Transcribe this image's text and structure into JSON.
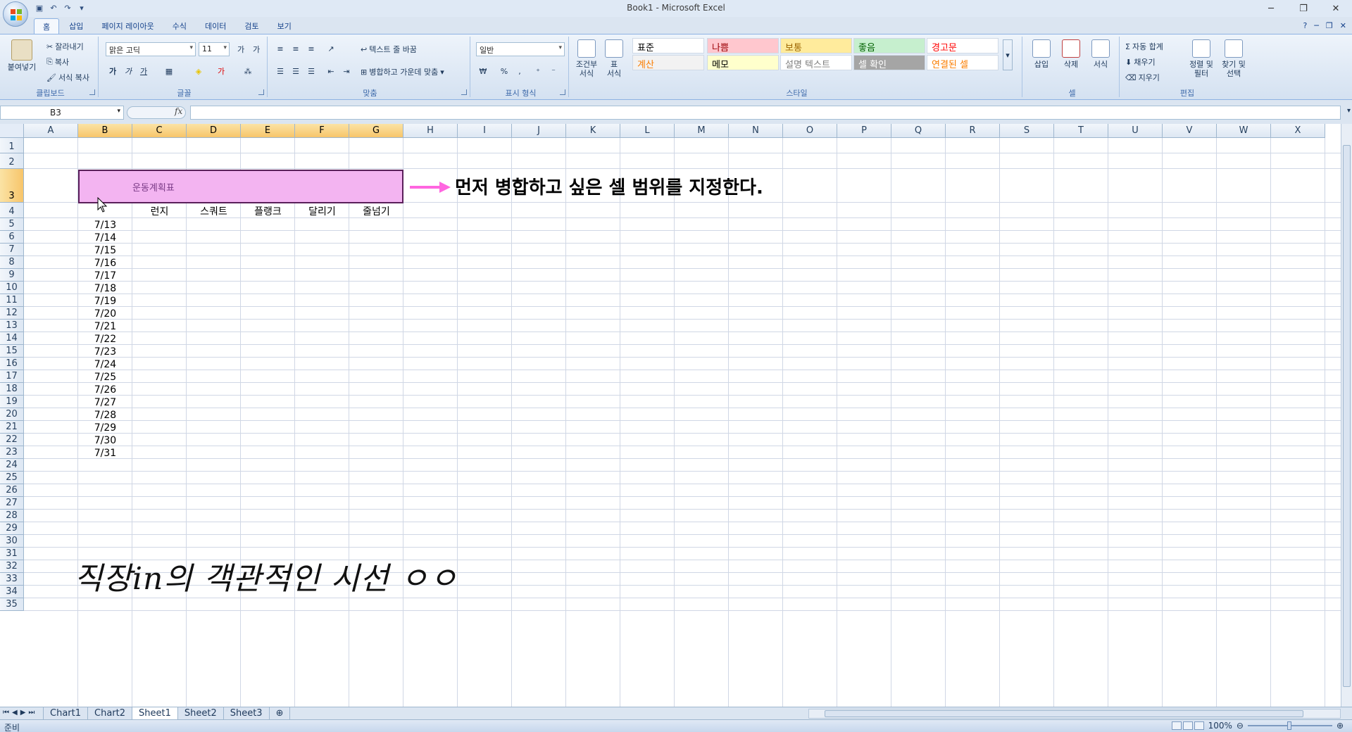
{
  "window": {
    "title": "Book1 - Microsoft Excel"
  },
  "qat": {
    "items": [
      "save-icon",
      "undo-icon",
      "redo-icon",
      "customize-icon"
    ]
  },
  "tabs": [
    "홈",
    "삽입",
    "페이지 레이아웃",
    "수식",
    "데이터",
    "검토",
    "보기"
  ],
  "ribbon": {
    "clipboard": {
      "label": "클립보드",
      "paste": "붙여넣기",
      "cut": "잘라내기",
      "copy": "복사",
      "format_painter": "서식 복사"
    },
    "font": {
      "label": "글꼴",
      "font_name": "맑은 고딕",
      "font_size": "11",
      "bold": "가",
      "italic": "가",
      "underline": "가"
    },
    "alignment": {
      "label": "맞춤",
      "wrap": "텍스트 줄 바꿈",
      "merge": "병합하고 가운데 맞춤"
    },
    "number": {
      "label": "표시 형식",
      "format": "일반",
      "currency": "₩",
      "percent": "%",
      "comma": ","
    },
    "cond": {
      "label1": "조건부",
      "label2": "서식",
      "table1": "표",
      "table2": "서식"
    },
    "styles": {
      "label": "스타일",
      "items": [
        {
          "text": "표준",
          "color": "#000000",
          "bg": "#ffffff"
        },
        {
          "text": "나쁨",
          "color": "#9c0006",
          "bg": "#ffc7ce"
        },
        {
          "text": "보통",
          "color": "#9c6500",
          "bg": "#ffeb9c"
        },
        {
          "text": "좋음",
          "color": "#006100",
          "bg": "#c6efce"
        },
        {
          "text": "경고문",
          "color": "#ff0000",
          "bg": "#ffffff"
        },
        {
          "text": "계산",
          "color": "#fa7d00",
          "bg": "#f2f2f2"
        },
        {
          "text": "메모",
          "color": "#000000",
          "bg": "#ffffcc"
        },
        {
          "text": "설명 텍스트",
          "color": "#7f7f7f",
          "bg": "#ffffff"
        },
        {
          "text": "셀 확인",
          "color": "#ffffff",
          "bg": "#a5a5a5"
        },
        {
          "text": "연결된 셀",
          "color": "#fa7d00",
          "bg": "#ffffff"
        }
      ]
    },
    "cells": {
      "label": "셀",
      "insert": "삽입",
      "delete": "삭제",
      "format": "서식"
    },
    "editing": {
      "label": "편집",
      "autosum": "자동 합계",
      "fill": "채우기",
      "clear": "지우기",
      "sort1": "정렬 및",
      "sort2": "필터",
      "find1": "찾기 및",
      "find2": "선택"
    }
  },
  "formula_bar": {
    "name_box": "B3",
    "fx": "fx",
    "value": ""
  },
  "grid": {
    "columns": [
      "A",
      "B",
      "C",
      "D",
      "E",
      "F",
      "G",
      "H",
      "I",
      "J",
      "K",
      "L",
      "M",
      "N",
      "O",
      "P",
      "Q",
      "R",
      "S",
      "T",
      "U",
      "V",
      "W",
      "X"
    ],
    "selected_columns": [
      "B",
      "C",
      "D",
      "E",
      "F",
      "G"
    ],
    "rows": [
      "1",
      "2",
      "3",
      "4",
      "5",
      "6",
      "7",
      "8",
      "9",
      "10",
      "11",
      "12",
      "13",
      "14",
      "15",
      "16",
      "17",
      "18",
      "19",
      "20",
      "21",
      "22",
      "23",
      "24",
      "25",
      "26",
      "27",
      "28",
      "29",
      "30",
      "31",
      "32",
      "33",
      "34",
      "35"
    ],
    "selected_row": "3",
    "merged_title": "운동계획표",
    "headers": [
      "런지",
      "스쿼트",
      "플랭크",
      "달리기",
      "줄넘기"
    ],
    "dates": [
      "7/13",
      "7/14",
      "7/15",
      "7/16",
      "7/17",
      "7/18",
      "7/19",
      "7/20",
      "7/21",
      "7/22",
      "7/23",
      "7/24",
      "7/25",
      "7/26",
      "7/27",
      "7/28",
      "7/29",
      "7/30",
      "7/31"
    ],
    "highlight_color": "#f3b4f1"
  },
  "annotation": {
    "text": "먼저 병합하고 싶은 셀 범위를 지정한다.",
    "arrow_color": "#ff66e0",
    "watermark": "직장in의 객관적인 시선 ㅇㅇ"
  },
  "sheets": {
    "tabs": [
      "Chart1",
      "Chart2",
      "Sheet1",
      "Sheet2",
      "Sheet3"
    ],
    "active": "Sheet1"
  },
  "status": {
    "text": "준비",
    "zoom": "100%"
  }
}
